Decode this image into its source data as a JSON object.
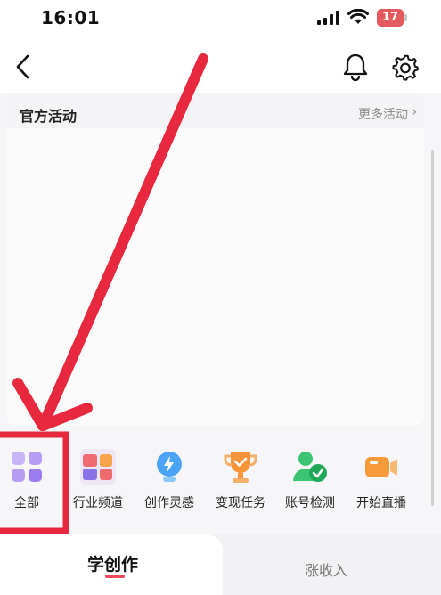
{
  "status_bar": {
    "time": "16:01",
    "battery_level": "17",
    "icons": [
      "signal-icon",
      "wifi-icon",
      "battery-icon"
    ]
  },
  "nav_bar": {
    "icons": [
      "back-chevron-icon",
      "bell-icon",
      "gear-icon"
    ]
  },
  "activity": {
    "title": "官方活动",
    "more_label": "更多活动",
    "more_chevron": "›"
  },
  "features": [
    {
      "label": "全部",
      "icon": "all-grid-icon",
      "color": "#b69cf2"
    },
    {
      "label": "行业频道",
      "icon": "industry-channel-icon",
      "color": "#f06a72"
    },
    {
      "label": "创作灵感",
      "icon": "lightbulb-icon",
      "color": "#4aa3f5"
    },
    {
      "label": "变现任务",
      "icon": "trophy-icon",
      "color": "#f7943a"
    },
    {
      "label": "账号检测",
      "icon": "account-check-icon",
      "color": "#3cc472"
    },
    {
      "label": "开始直播",
      "icon": "video-camera-icon",
      "color": "#f79a3a"
    }
  ],
  "tabs": [
    {
      "label": "学创作",
      "active": true
    },
    {
      "label": "涨收入",
      "active": false
    }
  ],
  "colors": {
    "accent": "#f04a5c",
    "annotation": "#e8283e"
  }
}
